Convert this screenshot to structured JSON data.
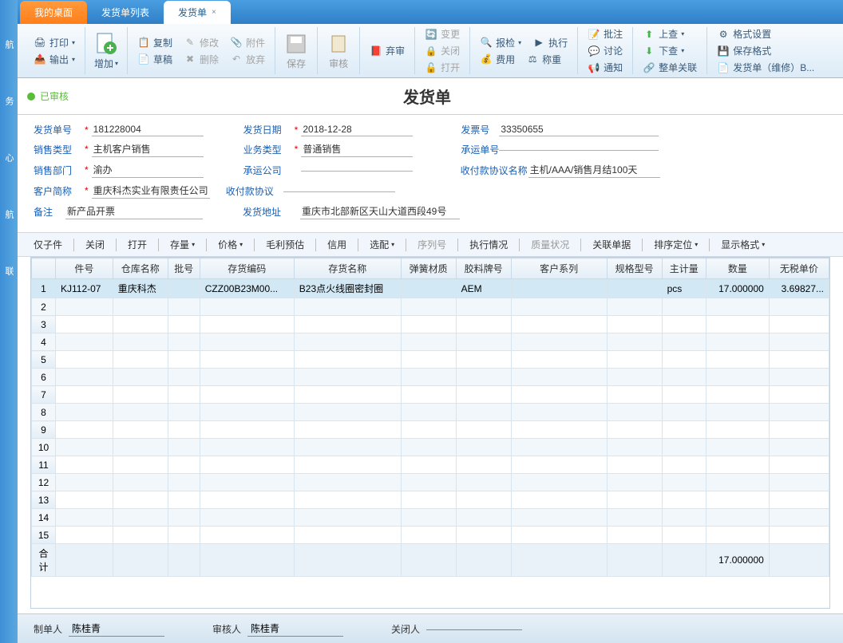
{
  "tabs": {
    "desktop": "我的桌面",
    "list": "发货单列表",
    "current": "发货单"
  },
  "ribbon": {
    "print": "打印",
    "export": "输出",
    "add": "增加",
    "copy": "复制",
    "modify": "修改",
    "attachment": "附件",
    "draft": "草稿",
    "delete": "删除",
    "release": "放弃",
    "save": "保存",
    "audit": "审核",
    "abandon": "弃审",
    "change": "变更",
    "close": "关闭",
    "open": "打开",
    "inspect": "报检",
    "execute": "执行",
    "fee": "费用",
    "weigh": "称重",
    "batch": "批注",
    "discuss": "讨论",
    "notify": "通知",
    "up": "上查",
    "down": "下查",
    "link": "整单关联",
    "format": "格式设置",
    "saveformat": "保存格式",
    "repair": "发货单（维修）B..."
  },
  "status": {
    "audited": "已审核"
  },
  "title": "发货单",
  "form": {
    "shipno_label": "发货单号",
    "shipno": "181228004",
    "saletype_label": "销售类型",
    "saletype": "主机客户销售",
    "dept_label": "销售部门",
    "dept": "渝办",
    "customer_label": "客户简称",
    "customer": "重庆科杰实业有限责任公司",
    "remark_label": "备注",
    "remark": "新产品开票",
    "shipdate_label": "发货日期",
    "shipdate": "2018-12-28",
    "biztype_label": "业务类型",
    "biztype": "普通销售",
    "carrier_label": "承运公司",
    "carrier": "",
    "payproto_label": "收付款协议",
    "payproto": "",
    "addr_label": "发货地址",
    "addr": "重庆市北部新区天山大道西段49号",
    "invoice_label": "发票号",
    "invoice": "33350655",
    "shipno2_label": "承运单号",
    "shipno2": "",
    "payname_label": "收付款协议名称",
    "payname": "主机/AAA/销售月结100天"
  },
  "toolbar2": {
    "onlychild": "仅子件",
    "close": "关闭",
    "open": "打开",
    "stock": "存量",
    "price": "价格",
    "gross": "毛利预估",
    "credit": "信用",
    "match": "选配",
    "seqno": "序列号",
    "exec": "执行情况",
    "quality": "质量状况",
    "linkdoc": "关联单据",
    "sort": "排序定位",
    "display": "显示格式"
  },
  "grid": {
    "headers": [
      "件号",
      "仓库名称",
      "批号",
      "存货编码",
      "存货名称",
      "弹簧材质",
      "胶料牌号",
      "客户系列",
      "规格型号",
      "主计量",
      "数量",
      "无税单价"
    ],
    "row1": {
      "partno": "KJ112-07",
      "wh": "重庆科杰",
      "batch": "",
      "code": "CZZ00B23M00...",
      "name": "B23点火线圈密封圈",
      "spring": "",
      "rubber": "AEM",
      "series": "",
      "spec": "",
      "uom": "pcs",
      "qty": "17.000000",
      "price": "3.69827..."
    },
    "total_label": "合计",
    "total_qty": "17.000000"
  },
  "bottom": {
    "maker_label": "制单人",
    "maker": "陈桂青",
    "auditor_label": "审核人",
    "auditor": "陈桂青",
    "closer_label": "关闭人",
    "closer": ""
  }
}
